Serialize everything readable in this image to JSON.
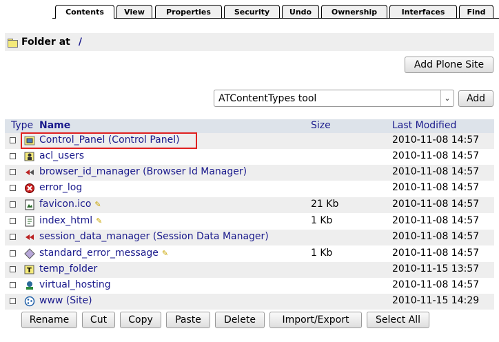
{
  "tabs": [
    {
      "label": "Contents",
      "active": true
    },
    {
      "label": "View"
    },
    {
      "label": "Properties"
    },
    {
      "label": "Security"
    },
    {
      "label": "Undo"
    },
    {
      "label": "Ownership"
    },
    {
      "label": "Interfaces"
    },
    {
      "label": "Find"
    }
  ],
  "folder": {
    "label": "Folder at",
    "path": "/"
  },
  "add_plone_site_label": "Add Plone Site",
  "add_select": {
    "value": "ATContentTypes tool",
    "button_label": "Add"
  },
  "table": {
    "headers": {
      "type": "Type",
      "name": "Name",
      "size": "Size",
      "modified": "Last Modified"
    },
    "rows": [
      {
        "icon": "control-panel-icon",
        "name": "Control_Panel (Control Panel)",
        "size": "",
        "modified": "2010-11-08 14:57",
        "editable": false
      },
      {
        "icon": "user-folder-icon",
        "name": "acl_users",
        "size": "",
        "modified": "2010-11-08 14:57",
        "editable": false
      },
      {
        "icon": "id-manager-icon",
        "name": "browser_id_manager (Browser Id Manager)",
        "size": "",
        "modified": "2010-11-08 14:57",
        "editable": false
      },
      {
        "icon": "error-log-icon",
        "name": "error_log",
        "size": "",
        "modified": "2010-11-08 14:57",
        "editable": false
      },
      {
        "icon": "image-icon",
        "name": "favicon.ico",
        "size": "21 Kb",
        "modified": "2010-11-08 14:57",
        "editable": true
      },
      {
        "icon": "dtml-document-icon",
        "name": "index_html",
        "size": "1 Kb",
        "modified": "2010-11-08 14:57",
        "editable": true
      },
      {
        "icon": "session-manager-icon",
        "name": "session_data_manager (Session Data Manager)",
        "size": "",
        "modified": "2010-11-08 14:57",
        "editable": false
      },
      {
        "icon": "dtml-method-icon",
        "name": "standard_error_message",
        "size": "1 Kb",
        "modified": "2010-11-08 14:57",
        "editable": true
      },
      {
        "icon": "temp-folder-icon",
        "name": "temp_folder",
        "size": "",
        "modified": "2010-11-15 13:57",
        "editable": false
      },
      {
        "icon": "virtual-hosting-icon",
        "name": "virtual_hosting",
        "size": "",
        "modified": "2010-11-08 14:57",
        "editable": false
      },
      {
        "icon": "plone-site-icon",
        "name": "www (Site)",
        "size": "",
        "modified": "2010-11-15 14:29",
        "editable": false
      }
    ]
  },
  "actions": [
    "Rename",
    "Cut",
    "Copy",
    "Paste",
    "Delete",
    "Import/Export",
    "Select All"
  ],
  "colors": {
    "link": "#1a1a8c",
    "header_bg": "#dde3ea",
    "row_alt": "#eeeeee",
    "highlight": "#e0201f"
  }
}
